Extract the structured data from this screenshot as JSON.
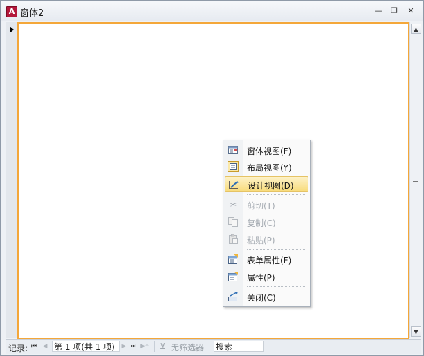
{
  "window": {
    "title": "窗体2",
    "app_icon_letter": "A"
  },
  "title_controls": {
    "minimize": "—",
    "restore": "❐",
    "close": "✕"
  },
  "navigation": {
    "label": "记录:",
    "record_text": "第 1 项(共 1 项)",
    "filter_text": "无筛选器",
    "search_value": "搜索"
  },
  "context_menu": {
    "items": [
      {
        "label": "窗体视图(F)",
        "icon": "form-view-icon",
        "enabled": true
      },
      {
        "label": "布局视图(Y)",
        "icon": "layout-view-icon",
        "enabled": true
      },
      {
        "label": "设计视图(D)",
        "icon": "design-view-icon",
        "enabled": true,
        "highlighted": true
      },
      {
        "label": "剪切(T)",
        "icon": "cut-icon",
        "enabled": false
      },
      {
        "label": "复制(C)",
        "icon": "copy-icon",
        "enabled": false
      },
      {
        "label": "粘贴(P)",
        "icon": "paste-icon",
        "enabled": false
      },
      {
        "label": "表单属性(F)",
        "icon": "form-properties-icon",
        "enabled": true
      },
      {
        "label": "属性(P)",
        "icon": "properties-icon",
        "enabled": true
      },
      {
        "label": "关闭(C)",
        "icon": "close-icon",
        "enabled": true
      }
    ]
  },
  "colors": {
    "form_border": "#f4a73a",
    "highlight_top": "#fdf2c8",
    "highlight_bottom": "#f8db7a"
  }
}
